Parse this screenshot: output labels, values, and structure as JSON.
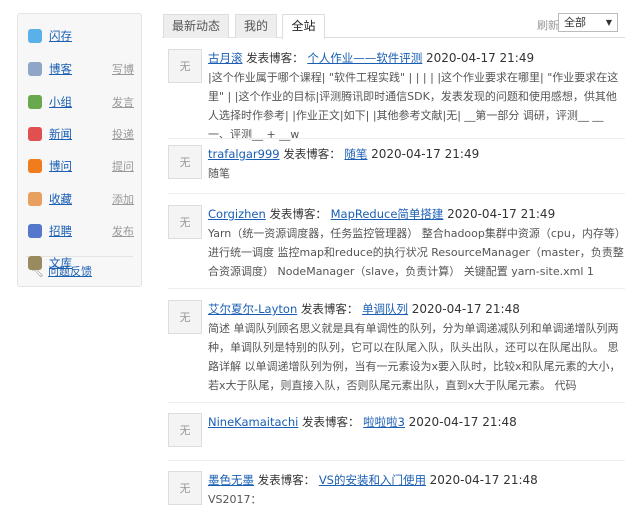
{
  "sidebar": {
    "items": [
      {
        "label": "闪存",
        "action": "",
        "icon": "chat-bubble-icon",
        "color": "#5ab0e8"
      },
      {
        "label": "博客",
        "action": "写博",
        "icon": "edit-note-icon",
        "color": "#8fa6c8"
      },
      {
        "label": "小组",
        "action": "发言",
        "icon": "group-icon",
        "color": "#6aa84f"
      },
      {
        "label": "新闻",
        "action": "投递",
        "icon": "news-icon",
        "color": "#e05050"
      },
      {
        "label": "博问",
        "action": "提问",
        "icon": "question-icon",
        "color": "#f07c1c"
      },
      {
        "label": "收藏",
        "action": "添加",
        "icon": "favorite-icon",
        "color": "#e8a060"
      },
      {
        "label": "招聘",
        "action": "发布",
        "icon": "job-icon",
        "color": "#5577cc"
      },
      {
        "label": "文库",
        "action": "",
        "icon": "book-icon",
        "color": "#9a8a60"
      }
    ],
    "feedback": "问题反馈"
  },
  "tabs": [
    {
      "label": "最新动态"
    },
    {
      "label": "我的"
    },
    {
      "label": "全站"
    }
  ],
  "refresh": "刷新",
  "filter": {
    "selected": "全部"
  },
  "posted_label": "发表博客：",
  "entries": [
    {
      "user": "古月滚",
      "title": "个人作业——软件评测",
      "time": "2020-04-17 21:49",
      "summary": "|这个作业属于哪个课程| \"软件工程实践\" | | | | |这个作业要求在哪里| \"作业要求在这里\" | |这个作业的目标|评测腾讯即时通信SDK，发表发现的问题和使用感想，供其他人选择时作参考| |作业正文|如下| |其他参考文献|无| __第一部分 调研，评测__ __一、评测__ + __w"
    },
    {
      "user": "trafalgar999",
      "title": "随笔",
      "time": "2020-04-17 21:49",
      "summary": "随笔"
    },
    {
      "user": "Corgizhen",
      "title": "MapReduce简单搭建",
      "time": "2020-04-17 21:49",
      "summary": "Yarn（统一资源调度器，任务监控管理器） 整合hadoop集群中资源（cpu，内存等）进行统一调度 监控map和reduce的执行状况 ResourceManager（master，负责整合资源调度） NodeManager（slave，负责计算） 关键配置 yarn-site.xml 1"
    },
    {
      "user": "艾尔夏尔-Layton",
      "title": "单调队列",
      "time": "2020-04-17 21:48",
      "summary": "简述 单调队列顾名思义就是具有单调性的队列，分为单调递减队列和单调递增队列两种，单调队列是特别的队列，它可以在队尾入队，队头出队，还可以在队尾出队。 思路详解 以单调递增队列为例，当有一元素设为x要入队时，比较x和队尾元素的大小，若x大于队尾，则直接入队，否则队尾元素出队，直到x大于队尾元素。 代码"
    },
    {
      "user": "NineKamaitachi",
      "title": "啦啦啦3",
      "time": "2020-04-17 21:48",
      "summary": ""
    },
    {
      "user": "墨色无墨",
      "title": "VS的安装和入门使用",
      "time": "2020-04-17 21:48",
      "summary": "VS2017："
    }
  ],
  "avatar_placeholder": "无"
}
